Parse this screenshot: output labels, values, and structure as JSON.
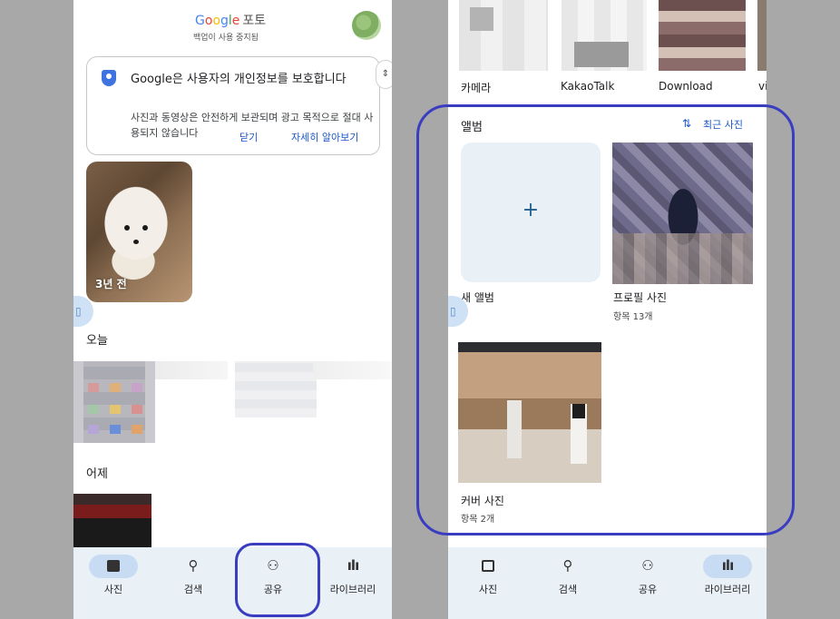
{
  "left_screen": {
    "header": {
      "logo_parts": [
        "G",
        "o",
        "o",
        "g",
        "l",
        "e"
      ],
      "app_suffix": "포토",
      "backup_status": "백업이 사용 중지됨"
    },
    "privacy_card": {
      "title": "Google은 사용자의 개인정보를 보호합니다",
      "body": "사진과 동영상은 안전하게 보관되며 광고 목적으로 절대 사용되지 않습니다",
      "dismiss_label": "닫기",
      "learn_more_label": "자세히 알아보기"
    },
    "memory": {
      "label": "3년 전"
    },
    "sections": {
      "today": "오늘",
      "yesterday": "어제"
    }
  },
  "right_screen": {
    "device_folders": [
      {
        "label": "카메라"
      },
      {
        "label": "KakaoTalk"
      },
      {
        "label": "Download"
      },
      {
        "label": "vi"
      }
    ],
    "albums_section": {
      "title": "앨범",
      "sort_label": "최근 사진",
      "new_album_label": "새 앨범",
      "albums": [
        {
          "name": "프로필 사진",
          "count": "항목 13개"
        },
        {
          "name": "커버 사진",
          "count": "항목 2개"
        }
      ]
    }
  },
  "bottom_nav": {
    "items": [
      {
        "label": "사진",
        "icon": "photo-icon"
      },
      {
        "label": "검색",
        "icon": "search-icon"
      },
      {
        "label": "공유",
        "icon": "people-icon"
      },
      {
        "label": "라이브러리",
        "icon": "library-icon"
      }
    ],
    "left_active": "사진",
    "right_active": "라이브러리"
  },
  "colors": {
    "accent_blue": "#1a57c8",
    "highlight": "#3a3dc0",
    "nav_bg": "#e9f1f7",
    "active_pill": "#c7dcf2"
  }
}
